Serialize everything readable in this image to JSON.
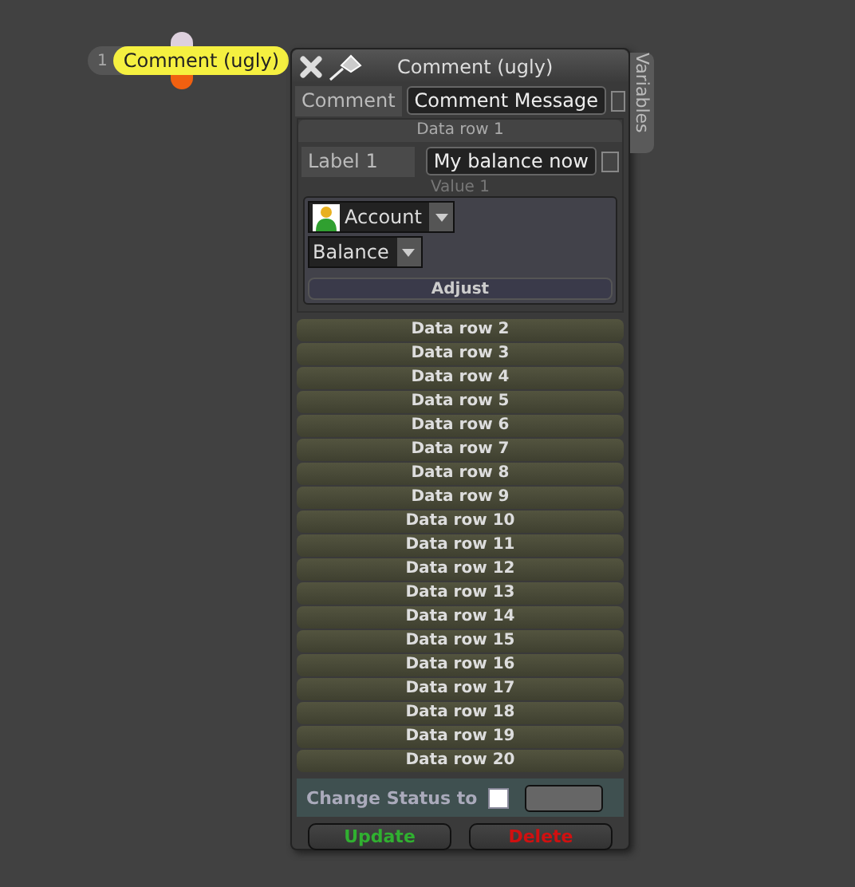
{
  "node": {
    "number": "1",
    "label": "Comment (ugly)"
  },
  "panel": {
    "title": "Comment (ugly)",
    "side_tab": "Variables",
    "comment": {
      "label": "Comment",
      "value": "Comment Message",
      "checked": false
    },
    "data_rows": [
      {
        "label": "Data row 1",
        "expanded": true,
        "field_label": "Label 1",
        "field_value": "My balance now",
        "checked": false,
        "value_caption": "Value 1",
        "dropdowns": [
          {
            "value": "Account",
            "kind": "account"
          },
          {
            "value": "Balance",
            "kind": "plain"
          }
        ],
        "action": "Adjust"
      },
      {
        "label": "Data row 2",
        "expanded": false
      },
      {
        "label": "Data row 3",
        "expanded": false
      },
      {
        "label": "Data row 4",
        "expanded": false
      },
      {
        "label": "Data row 5",
        "expanded": false
      },
      {
        "label": "Data row 6",
        "expanded": false
      },
      {
        "label": "Data row 7",
        "expanded": false
      },
      {
        "label": "Data row 8",
        "expanded": false
      },
      {
        "label": "Data row 9",
        "expanded": false
      },
      {
        "label": "Data row 10",
        "expanded": false
      },
      {
        "label": "Data row 11",
        "expanded": false
      },
      {
        "label": "Data row 12",
        "expanded": false
      },
      {
        "label": "Data row 13",
        "expanded": false
      },
      {
        "label": "Data row 14",
        "expanded": false
      },
      {
        "label": "Data row 15",
        "expanded": false
      },
      {
        "label": "Data row 16",
        "expanded": false
      },
      {
        "label": "Data row 17",
        "expanded": false
      },
      {
        "label": "Data row 18",
        "expanded": false
      },
      {
        "label": "Data row 19",
        "expanded": false
      },
      {
        "label": "Data row 20",
        "expanded": false
      }
    ],
    "status": {
      "label": "Change Status to",
      "checked": false
    },
    "buttons": [
      {
        "label": "Update",
        "kind": "update"
      },
      {
        "label": "Delete",
        "kind": "delete"
      }
    ]
  }
}
